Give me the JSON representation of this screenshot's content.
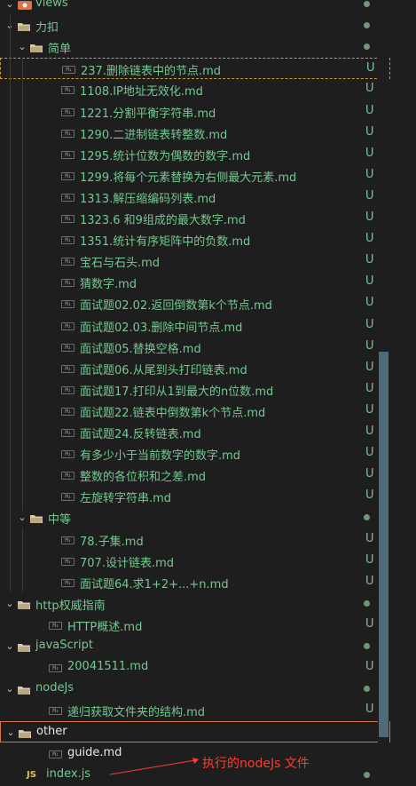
{
  "tree": {
    "root": {
      "label": "views"
    },
    "likou": {
      "label": "力扣"
    },
    "simple": {
      "label": "简单"
    },
    "simple_files": [
      "237.删除链表中的节点.md",
      "1108.IP地址无效化.md",
      "1221.分割平衡字符串.md",
      "1290.二进制链表转整数.md",
      "1295.统计位数为偶数的数字.md",
      "1299.将每个元素替换为右侧最大元素.md",
      "1313.解压缩编码列表.md",
      "1323.6 和9组成的最大数字.md",
      "1351.统计有序矩阵中的负数.md",
      "宝石与石头.md",
      "猜数字.md",
      "面试题02.02.返回倒数第k个节点.md",
      "面试题02.03.删除中间节点.md",
      "面试题05.替换空格.md",
      "面试题06.从尾到头打印链表.md",
      "面试题17.打印从1到最大的n位数.md",
      "面试题22.链表中倒数第k个节点.md",
      "面试题24.反转链表.md",
      "有多少小于当前数字的数字.md",
      "整数的各位积和之差.md",
      "左旋转字符串.md"
    ],
    "medium": {
      "label": "中等"
    },
    "medium_files": [
      "78.子集.md",
      "707.设计链表.md",
      "面试题64.求1+2+...+n.md"
    ],
    "http": {
      "label": "http权威指南"
    },
    "http_files": [
      "HTTP概述.md"
    ],
    "javascript": {
      "label": "javaScript"
    },
    "javascript_files": [
      "20041511.md"
    ],
    "nodejs": {
      "label": "nodeJs"
    },
    "nodejs_files": [
      "递归获取文件夹的结构.md"
    ],
    "other": {
      "label": "other"
    },
    "other_files": [
      "guide.md"
    ],
    "root_files": [
      "index.js"
    ],
    "status_untracked": "U",
    "md_icon": "M↓",
    "js_icon": "JS"
  },
  "annotation": {
    "text": "执行的nodeJs 文件"
  },
  "colors": {
    "background": "#1e1e1e",
    "untracked_green": "#73c991",
    "folder_beige": "#d9c9a3",
    "annotation_red": "#ff3b2f",
    "scroll_thumb": "#4f6b79"
  },
  "icons": {
    "folder": "folder-open-icon",
    "markdown": "markdown-icon",
    "javascript": "javascript-icon",
    "chevron": "chevron-down-icon",
    "status_dot": "git-modified-dot-icon"
  }
}
